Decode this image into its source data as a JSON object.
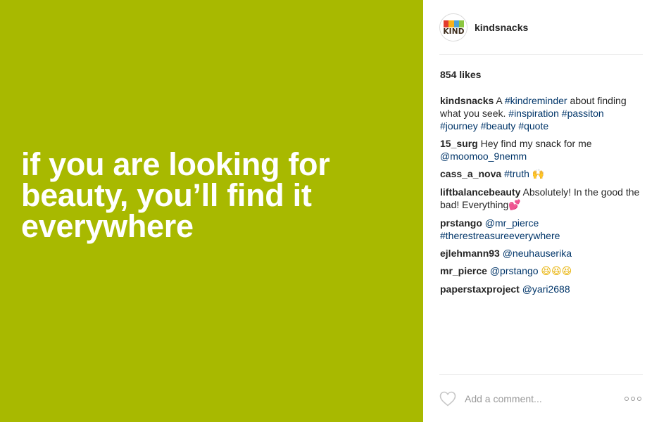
{
  "post": {
    "image": {
      "background_color": "#a8b900",
      "quote_lines": [
        "if you are looking for",
        "beauty, you’ll find it",
        "everywhere"
      ]
    },
    "header": {
      "avatar_text": "KIND",
      "avatar_colors": [
        "#e23b2e",
        "#f6b11b",
        "#4ca1d9",
        "#8cc63f"
      ],
      "username": "kindsnacks"
    },
    "likes": "854 likes",
    "caption": {
      "user": "kindsnacks",
      "parts": [
        {
          "text": " A ",
          "type": "text"
        },
        {
          "text": "#kindreminder",
          "type": "link"
        },
        {
          "text": " about finding what you seek. ",
          "type": "text"
        },
        {
          "text": "#inspiration",
          "type": "link"
        },
        {
          "text": " ",
          "type": "text"
        },
        {
          "text": "#passiton",
          "type": "link"
        },
        {
          "text": " ",
          "type": "text"
        },
        {
          "text": "#journey",
          "type": "link"
        },
        {
          "text": " ",
          "type": "text"
        },
        {
          "text": "#beauty",
          "type": "link"
        },
        {
          "text": " ",
          "type": "text"
        },
        {
          "text": "#quote",
          "type": "link"
        }
      ]
    },
    "comments": [
      {
        "user": "15_surg",
        "parts": [
          {
            "text": " Hey find my snack for me ",
            "type": "text"
          },
          {
            "text": "@moomoo_9nemm",
            "type": "link"
          }
        ]
      },
      {
        "user": "cass_a_nova",
        "parts": [
          {
            "text": " ",
            "type": "text"
          },
          {
            "text": "#truth",
            "type": "link"
          },
          {
            "text": " ",
            "type": "text"
          },
          {
            "text": "🙌",
            "type": "emoji",
            "class": "raised-hands",
            "icon": "raised-hands-emoji-icon"
          }
        ]
      },
      {
        "user": "liftbalancebeauty",
        "parts": [
          {
            "text": " Absolutely! In the good the bad! Everything",
            "type": "text"
          },
          {
            "text": "💕",
            "type": "emoji",
            "class": "hearts",
            "icon": "two-hearts-emoji-icon"
          }
        ]
      },
      {
        "user": "prstango",
        "parts": [
          {
            "text": " ",
            "type": "text"
          },
          {
            "text": "@mr_pierce",
            "type": "link"
          },
          {
            "text": " ",
            "type": "text"
          },
          {
            "text": "#therestreasureeverywhere",
            "type": "link"
          }
        ]
      },
      {
        "user": "ejlehmann93",
        "parts": [
          {
            "text": " ",
            "type": "text"
          },
          {
            "text": "@neuhauserika",
            "type": "link"
          }
        ]
      },
      {
        "user": "mr_pierce",
        "parts": [
          {
            "text": " ",
            "type": "text"
          },
          {
            "text": "@prstango",
            "type": "link"
          },
          {
            "text": " ",
            "type": "text"
          },
          {
            "text": "😆😆😆",
            "type": "emoji",
            "class": "laugh",
            "icon": "laughing-emoji-icon"
          }
        ]
      },
      {
        "user": "paperstaxproject",
        "parts": [
          {
            "text": " ",
            "type": "text"
          },
          {
            "text": "@yari2688",
            "type": "link"
          }
        ]
      }
    ],
    "footer": {
      "add_comment_placeholder": "Add a comment...",
      "like_icon": "heart-outline-icon",
      "more_icon": "more-options-icon"
    }
  }
}
